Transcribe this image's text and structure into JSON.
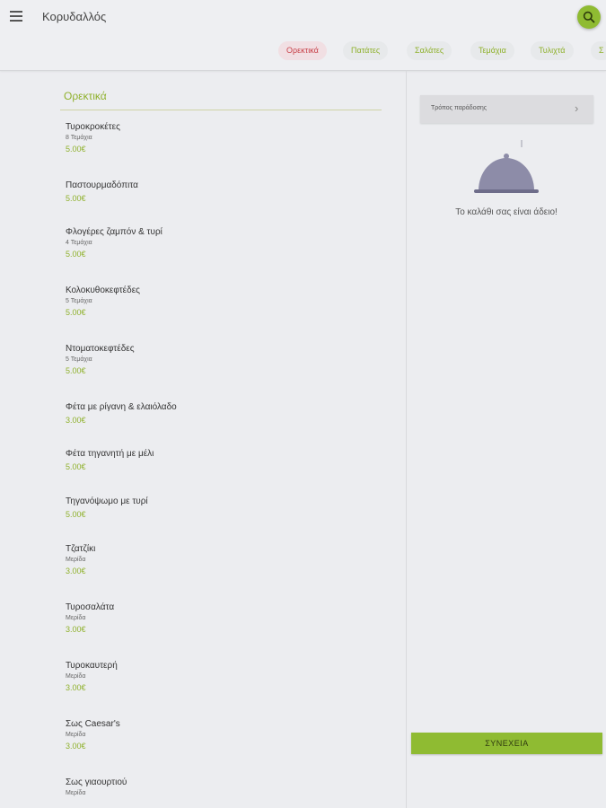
{
  "header": {
    "title": "Κορυδαλλός",
    "menu_icon": "menu-icon",
    "search_icon": "search-icon",
    "accent_color": "#8fbb32"
  },
  "tabs": [
    {
      "label": "Ορεκτικά",
      "active": true
    },
    {
      "label": "Πατάτες",
      "active": false
    },
    {
      "label": "Σαλάτες",
      "active": false
    },
    {
      "label": "Τεμάχια",
      "active": false
    },
    {
      "label": "Τυλιχτά",
      "active": false
    },
    {
      "label": "Σ",
      "active": false
    }
  ],
  "menu": {
    "section_title": "Ορεκτικά",
    "products": [
      {
        "name": "Τυροκροκέτες",
        "desc": "8 Τεμάχια",
        "price": "5.00€"
      },
      {
        "name": "Παστουρμαδόπιτα",
        "desc": "",
        "price": "5.00€"
      },
      {
        "name": "Φλογέρες ζαμπόν & τυρί",
        "desc": "4 Τεμάχια",
        "price": "5.00€"
      },
      {
        "name": "Κολοκυθοκεφτέδες",
        "desc": "5 Τεμάχια",
        "price": "5.00€"
      },
      {
        "name": "Ντοματοκεφτέδες",
        "desc": "5 Τεμάχια",
        "price": "5.00€"
      },
      {
        "name": "Φέτα με ρίγανη & ελαιόλαδο",
        "desc": "",
        "price": "3.00€"
      },
      {
        "name": "Φέτα τηγανητή με μέλι",
        "desc": "",
        "price": "5.00€"
      },
      {
        "name": "Τηγανόψωμο με τυρί",
        "desc": "",
        "price": "5.00€"
      },
      {
        "name": "Τζατζίκι",
        "desc": "Μερίδα",
        "price": "3.00€"
      },
      {
        "name": "Τυροσαλάτα",
        "desc": "Μερίδα",
        "price": "3.00€"
      },
      {
        "name": "Τυροκαυτερή",
        "desc": "Μερίδα",
        "price": "3.00€"
      },
      {
        "name": "Σως Caesar's",
        "desc": "Μερίδα",
        "price": "3.00€"
      },
      {
        "name": "Σως γιαουρτιού",
        "desc": "Μερίδα",
        "price": ""
      }
    ]
  },
  "cart": {
    "delivery_label": "Τρόπος παράδοσης",
    "chevron_icon": "chevron-right-icon",
    "empty_icon": "cloche-icon",
    "empty_text": "Το καλάθι σας είναι άδειο!",
    "continue_label": "ΣΥΝΕΧΕΙΑ"
  }
}
